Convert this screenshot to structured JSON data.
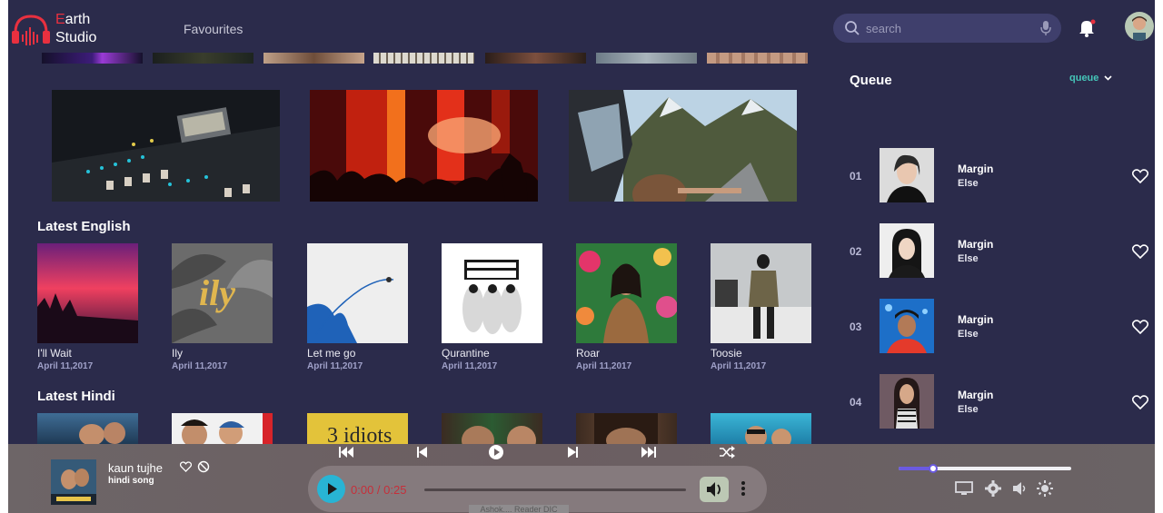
{
  "brand": {
    "first_letter": "E",
    "rest_line1": "arth",
    "line2": "Studio",
    "accent": "#e8303f"
  },
  "nav": {
    "favourites": "Favourites"
  },
  "search": {
    "placeholder": "search"
  },
  "icons": [
    "headphones-logo-icon",
    "search-icon",
    "mic-icon",
    "bell-icon",
    "heart-icon",
    "block-icon",
    "skip-back-icon",
    "prev-icon",
    "play-circle-icon",
    "next-icon",
    "skip-forward-icon",
    "shuffle-icon",
    "play-icon",
    "volume-icon",
    "more-icon",
    "monitor-icon",
    "settings-icon",
    "speaker-icon",
    "brightness-icon",
    "chevron-down-icon"
  ],
  "sections": {
    "english": {
      "title": "Latest English",
      "items": [
        {
          "name": "I'll Wait",
          "date": "April 11,2017"
        },
        {
          "name": "Ily",
          "date": "April 11,2017"
        },
        {
          "name": "Let me go",
          "date": "April 11,2017"
        },
        {
          "name": "Qurantine",
          "date": "April 11,2017"
        },
        {
          "name": "Roar",
          "date": "April 11,2017"
        },
        {
          "name": "Toosie",
          "date": "April 11,2017"
        }
      ]
    },
    "hindi": {
      "title": "Latest Hindi"
    }
  },
  "queue": {
    "title": "Queue",
    "filter": "queue",
    "items": [
      {
        "num": "01",
        "title": "Margin",
        "artist": "Else"
      },
      {
        "num": "02",
        "title": "Margin",
        "artist": "Else"
      },
      {
        "num": "03",
        "title": "Margin",
        "artist": "Else"
      },
      {
        "num": "04",
        "title": "Margin",
        "artist": "Else"
      }
    ]
  },
  "player": {
    "title": "kaun tujhe",
    "subtitle": "hindi song",
    "time": "0:00 / 0:25",
    "tooltip": "Ashok.... Reader DIC",
    "progress": 0,
    "volume": 0.2
  },
  "colors": {
    "background": "#2b2b4b",
    "accent_teal": "#45c6b9",
    "play_button": "#28b4d4",
    "time_text": "#c62f3a"
  }
}
